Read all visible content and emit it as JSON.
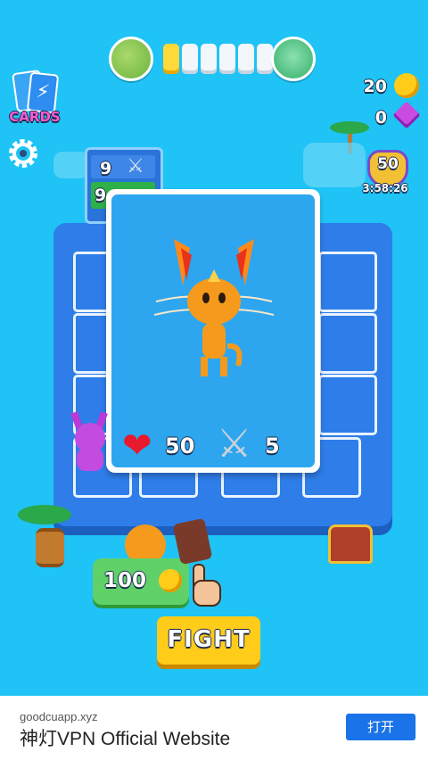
{
  "cards_button": {
    "label": "CARDS"
  },
  "progress": {
    "segments_total": 6,
    "segments_filled": 1
  },
  "currency": {
    "coins": "20",
    "gems": "0"
  },
  "level_badge": {
    "level": "50",
    "timer": "3:58:26"
  },
  "mini_card": {
    "attack": "9",
    "health": "9"
  },
  "card": {
    "health": "50",
    "attack": "5"
  },
  "buy": {
    "price": "100"
  },
  "fight_button": {
    "label": "FIGHT"
  },
  "ad": {
    "domain": "goodcuapp.xyz",
    "title": "神灯VPN Official Website",
    "button": "打开"
  },
  "colors": {
    "background": "#1fc3f5",
    "board": "#2e7de9",
    "card": "#2da6ef",
    "fight": "#ffcc1a"
  }
}
